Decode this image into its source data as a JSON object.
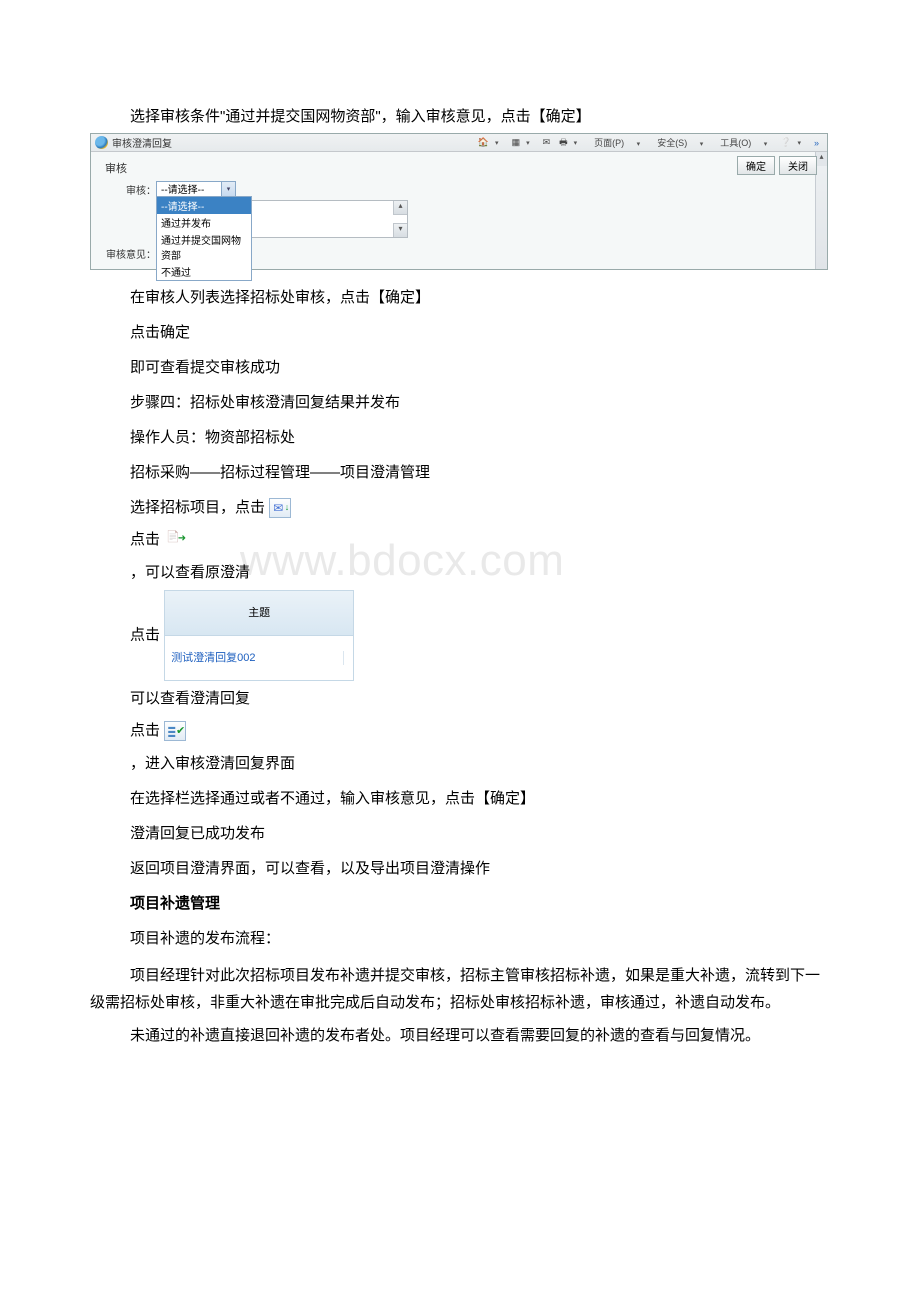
{
  "intro": "选择审核条件\"通过并提交国网物资部\"，输入审核意见，点击【确定】",
  "dialog": {
    "title": "审核澄清回复",
    "toolbar": {
      "page": "页面(P)",
      "safety": "安全(S)",
      "tools": "工具(O)"
    },
    "section_title": "审核",
    "confirm": "确定",
    "close": "关闭",
    "label_select": "审核：",
    "select_placeholder": "--请选择--",
    "options": [
      "--请选择--",
      "通过并发布",
      "通过并提交国网物资部",
      "不通过"
    ],
    "label_opinion": "审核意见："
  },
  "body": {
    "p1": "在审核人列表选择招标处审核，点击【确定】",
    "p2": "点击确定",
    "p3": "即可查看提交审核成功",
    "p4": "步骤四：招标处审核澄清回复结果并发布",
    "p5": "操作人员：物资部招标处",
    "p6": "招标采购——招标过程管理——项目澄清管理",
    "p7_pre": "选择招标项目，点击",
    "p8_pre": "点击",
    "p9": "，可以查看原澄清",
    "p10_pre": "点击",
    "subject_header": "主题",
    "subject_link": "测试澄清回复002",
    "p11": "可以查看澄清回复",
    "p12_pre": "点击",
    "p13": "，进入审核澄清回复界面",
    "p14": "在选择栏选择通过或者不通过，输入审核意见，点击【确定】",
    "p15": "澄清回复已成功发布",
    "p16": "返回项目澄清界面，可以查看，以及导出项目澄清操作",
    "h_bold": "项目补遗管理",
    "p17": "项目补遗的发布流程：",
    "p18": "项目经理针对此次招标项目发布补遗并提交审核，招标主管审核招标补遗，如果是重大补遗，流转到下一级需招标处审核，非重大补遗在审批完成后自动发布；招标处审核招标补遗，审核通过，补遗自动发布。",
    "p19": "未通过的补遗直接退回补遗的发布者处。项目经理可以查看需要回复的补遗的查看与回复情况。"
  },
  "watermark": "www.bdocx.com"
}
